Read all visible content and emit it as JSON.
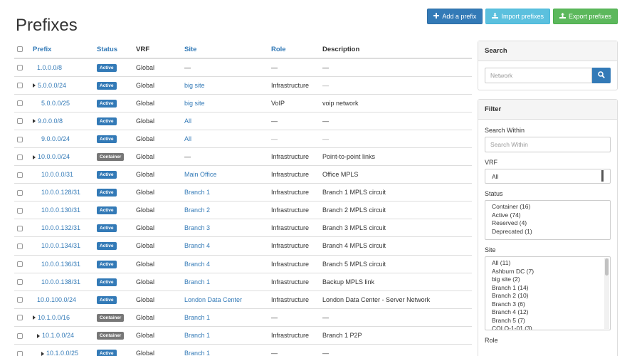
{
  "page": {
    "title": "Prefixes"
  },
  "actions": {
    "add": "Add a prefix",
    "import": "Import prefixes",
    "export": "Export prefixes"
  },
  "table": {
    "columns": [
      "Prefix",
      "Status",
      "VRF",
      "Site",
      "Role",
      "Description"
    ],
    "rows": [
      {
        "prefix": "1.0.0.0/8",
        "depth": 0,
        "expand": false,
        "status": "Active",
        "vrf": "Global",
        "site": "—",
        "site_link": false,
        "role": "—",
        "role_muted": false,
        "description": "—",
        "desc_muted": false
      },
      {
        "prefix": "5.0.0.0/24",
        "depth": 0,
        "expand": true,
        "status": "Active",
        "vrf": "Global",
        "site": "big site",
        "site_link": true,
        "role": "Infrastructure",
        "role_muted": false,
        "description": "—",
        "desc_muted": true
      },
      {
        "prefix": "5.0.0.0/25",
        "depth": 1,
        "expand": false,
        "status": "Active",
        "vrf": "Global",
        "site": "big site",
        "site_link": true,
        "role": "VoIP",
        "role_muted": false,
        "description": "voip network",
        "desc_muted": false
      },
      {
        "prefix": "9.0.0.0/8",
        "depth": 0,
        "expand": true,
        "status": "Active",
        "vrf": "Global",
        "site": "All",
        "site_link": true,
        "role": "—",
        "role_muted": false,
        "description": "—",
        "desc_muted": false
      },
      {
        "prefix": "9.0.0.0/24",
        "depth": 1,
        "expand": false,
        "status": "Active",
        "vrf": "Global",
        "site": "All",
        "site_link": true,
        "role": "—",
        "role_muted": true,
        "description": "—",
        "desc_muted": true
      },
      {
        "prefix": "10.0.0.0/24",
        "depth": 0,
        "expand": true,
        "status": "Container",
        "vrf": "Global",
        "site": "—",
        "site_link": false,
        "role": "Infrastructure",
        "role_muted": false,
        "description": "Point-to-point links",
        "desc_muted": false
      },
      {
        "prefix": "10.0.0.0/31",
        "depth": 1,
        "expand": false,
        "status": "Active",
        "vrf": "Global",
        "site": "Main Office",
        "site_link": true,
        "role": "Infrastructure",
        "role_muted": false,
        "description": "Office MPLS",
        "desc_muted": false
      },
      {
        "prefix": "10.0.0.128/31",
        "depth": 1,
        "expand": false,
        "status": "Active",
        "vrf": "Global",
        "site": "Branch 1",
        "site_link": true,
        "role": "Infrastructure",
        "role_muted": false,
        "description": "Branch 1 MPLS circuit",
        "desc_muted": false
      },
      {
        "prefix": "10.0.0.130/31",
        "depth": 1,
        "expand": false,
        "status": "Active",
        "vrf": "Global",
        "site": "Branch 2",
        "site_link": true,
        "role": "Infrastructure",
        "role_muted": false,
        "description": "Branch 2 MPLS circuit",
        "desc_muted": false
      },
      {
        "prefix": "10.0.0.132/31",
        "depth": 1,
        "expand": false,
        "status": "Active",
        "vrf": "Global",
        "site": "Branch 3",
        "site_link": true,
        "role": "Infrastructure",
        "role_muted": false,
        "description": "Branch 3 MPLS circuit",
        "desc_muted": false
      },
      {
        "prefix": "10.0.0.134/31",
        "depth": 1,
        "expand": false,
        "status": "Active",
        "vrf": "Global",
        "site": "Branch 4",
        "site_link": true,
        "role": "Infrastructure",
        "role_muted": false,
        "description": "Branch 4 MPLS circuit",
        "desc_muted": false
      },
      {
        "prefix": "10.0.0.136/31",
        "depth": 1,
        "expand": false,
        "status": "Active",
        "vrf": "Global",
        "site": "Branch 4",
        "site_link": true,
        "role": "Infrastructure",
        "role_muted": false,
        "description": "Branch 5 MPLS circuit",
        "desc_muted": false
      },
      {
        "prefix": "10.0.0.138/31",
        "depth": 1,
        "expand": false,
        "status": "Active",
        "vrf": "Global",
        "site": "Branch 1",
        "site_link": true,
        "role": "Infrastructure",
        "role_muted": false,
        "description": "Backup MPLS link",
        "desc_muted": false
      },
      {
        "prefix": "10.0.100.0/24",
        "depth": 0,
        "expand": false,
        "status": "Active",
        "vrf": "Global",
        "site": "London Data Center",
        "site_link": true,
        "role": "Infrastructure",
        "role_muted": false,
        "description": "London Data Center - Server Network",
        "desc_muted": false
      },
      {
        "prefix": "10.1.0.0/16",
        "depth": 0,
        "expand": true,
        "status": "Container",
        "vrf": "Global",
        "site": "Branch 1",
        "site_link": true,
        "role": "—",
        "role_muted": false,
        "description": "—",
        "desc_muted": false
      },
      {
        "prefix": "10.1.0.0/24",
        "depth": 1,
        "expand": true,
        "status": "Container",
        "vrf": "Global",
        "site": "Branch 1",
        "site_link": true,
        "role": "Infrastructure",
        "role_muted": false,
        "description": "Branch 1 P2P",
        "desc_muted": false
      },
      {
        "prefix": "10.1.0.0/25",
        "depth": 2,
        "expand": true,
        "status": "Active",
        "vrf": "Global",
        "site": "Branch 1",
        "site_link": true,
        "role": "—",
        "role_muted": false,
        "description": "—",
        "desc_muted": false
      }
    ]
  },
  "search_panel": {
    "heading": "Search",
    "placeholder": "Network"
  },
  "filter_panel": {
    "heading": "Filter",
    "search_within_label": "Search Within",
    "search_within_placeholder": "Search Within",
    "vrf_label": "VRF",
    "vrf_value": "All",
    "status_label": "Status",
    "status_options": [
      "Container (16)",
      "Active (74)",
      "Reserved (4)",
      "Deprecated (1)"
    ],
    "site_label": "Site",
    "site_options": [
      "All (11)",
      "Ashburn DC (7)",
      "big site (2)",
      "Branch 1 (14)",
      "Branch 2 (10)",
      "Branch 3 (6)",
      "Branch 4 (12)",
      "Branch 5 (7)",
      "COLO-1-01 (3)"
    ],
    "role_label": "Role"
  },
  "colors": {
    "primary": "#337ab7",
    "info": "#5bc0de",
    "success": "#5cb85c",
    "container": "#777777"
  }
}
